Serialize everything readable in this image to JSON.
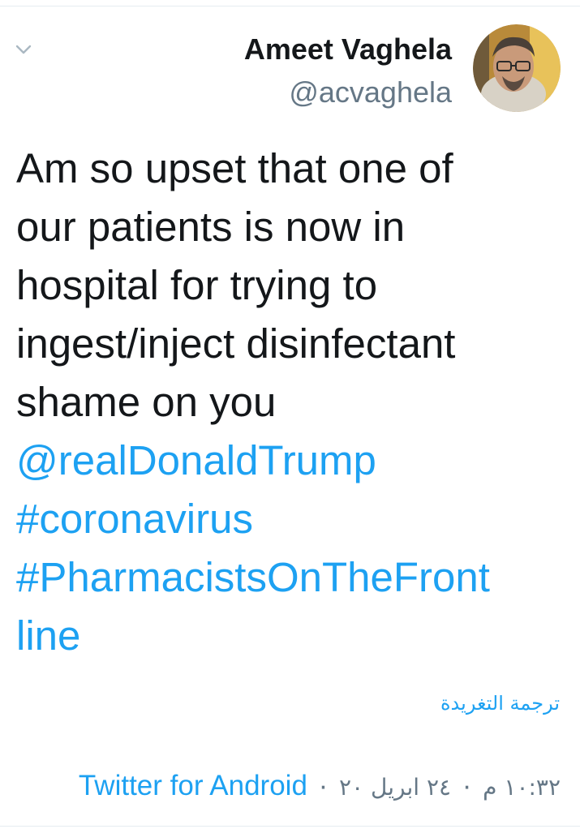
{
  "tweet": {
    "author": {
      "display_name": "Ameet Vaghela",
      "handle": "@acvaghela"
    },
    "text_lines": [
      "Am so upset that one of",
      "our patients is now in",
      "hospital for trying to",
      "ingest/inject disinfectant",
      "shame on you"
    ],
    "mention": "@realDonaldTrump",
    "hashtags": [
      "#coronavirus",
      "#PharmacistsOnTheFront",
      "line"
    ],
    "translate_label": "ترجمة التغريدة",
    "time": "١٠:٣٢ م",
    "date": "٢٤ ابريل ٢٠",
    "separator": "·",
    "source": "Twitter for Android"
  },
  "icons": {
    "menu": "chevron-down-icon",
    "avatar": "profile-photo"
  },
  "colors": {
    "text": "#14171a",
    "secondary": "#657786",
    "link": "#1da1f2",
    "divider": "#e6ecf0"
  }
}
